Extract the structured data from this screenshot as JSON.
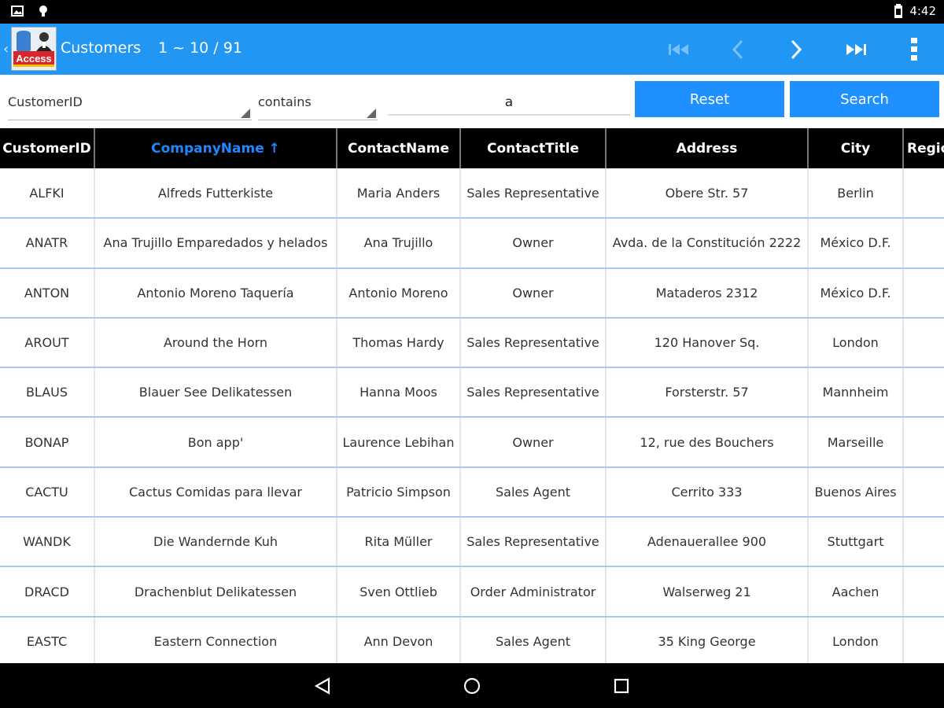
{
  "status": {
    "time": "4:42"
  },
  "appbar": {
    "logo_text": "Access",
    "title": "Customers",
    "range": "1 ~ 10 / 91"
  },
  "filter": {
    "field": "CustomerID",
    "operator": "contains",
    "value": "a",
    "reset_label": "Reset",
    "search_label": "Search"
  },
  "table": {
    "columns": [
      "CustomerID",
      "CompanyName ↑",
      "ContactName",
      "ContactTitle",
      "Address",
      "City",
      "Region"
    ],
    "rows": [
      [
        "ALFKI",
        "Alfreds Futterkiste",
        "Maria Anders",
        "Sales Representative",
        "Obere Str. 57",
        "Berlin",
        ""
      ],
      [
        "ANATR",
        "Ana Trujillo Emparedados y helados",
        "Ana Trujillo",
        "Owner",
        "Avda. de la Constitución 2222",
        "México D.F.",
        ""
      ],
      [
        "ANTON",
        "Antonio Moreno Taquería",
        "Antonio Moreno",
        "Owner",
        "Mataderos  2312",
        "México D.F.",
        ""
      ],
      [
        "AROUT",
        "Around the Horn",
        "Thomas Hardy",
        "Sales Representative",
        "120 Hanover Sq.",
        "London",
        ""
      ],
      [
        "BLAUS",
        "Blauer See Delikatessen",
        "Hanna Moos",
        "Sales Representative",
        "Forsterstr. 57",
        "Mannheim",
        ""
      ],
      [
        "BONAP",
        "Bon app'",
        "Laurence Lebihan",
        "Owner",
        "12, rue des Bouchers",
        "Marseille",
        ""
      ],
      [
        "CACTU",
        "Cactus Comidas para llevar",
        "Patricio Simpson",
        "Sales Agent",
        "Cerrito 333",
        "Buenos Aires",
        ""
      ],
      [
        "WANDK",
        "Die Wandernde Kuh",
        "Rita Müller",
        "Sales Representative",
        "Adenauerallee 900",
        "Stuttgart",
        ""
      ],
      [
        "DRACD",
        "Drachenblut Delikatessen",
        "Sven Ottlieb",
        "Order Administrator",
        "Walserweg 21",
        "Aachen",
        ""
      ],
      [
        "EASTC",
        "Eastern Connection",
        "Ann Devon",
        "Sales Agent",
        "35 King George",
        "London",
        ""
      ]
    ]
  }
}
